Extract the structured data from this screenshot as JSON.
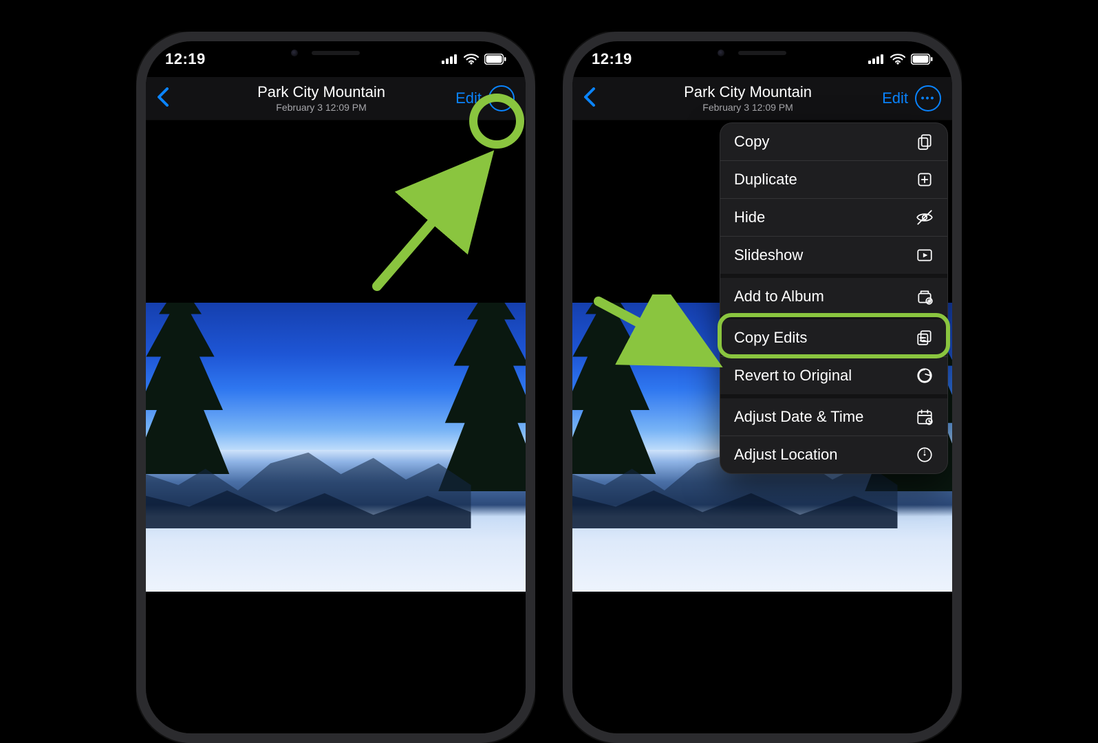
{
  "status": {
    "time": "12:19"
  },
  "nav": {
    "title": "Park City Mountain",
    "subtitle": "February 3  12:09 PM",
    "edit_label": "Edit"
  },
  "menu": {
    "items": [
      {
        "label": "Copy",
        "icon": "copy-icon"
      },
      {
        "label": "Duplicate",
        "icon": "duplicate-icon"
      },
      {
        "label": "Hide",
        "icon": "hide-icon"
      },
      {
        "label": "Slideshow",
        "icon": "slideshow-icon"
      },
      {
        "label": "Add to Album",
        "icon": "add-to-album-icon",
        "group_start": true
      },
      {
        "label": "Copy Edits",
        "icon": "copy-edits-icon",
        "group_start": true,
        "highlighted": true
      },
      {
        "label": "Revert to Original",
        "icon": "revert-icon"
      },
      {
        "label": "Adjust Date & Time",
        "icon": "adjust-date-icon",
        "group_start": true
      },
      {
        "label": "Adjust Location",
        "icon": "adjust-location-icon"
      }
    ]
  },
  "annotation": {
    "left_target": "more-button",
    "right_target": "Copy Edits"
  }
}
